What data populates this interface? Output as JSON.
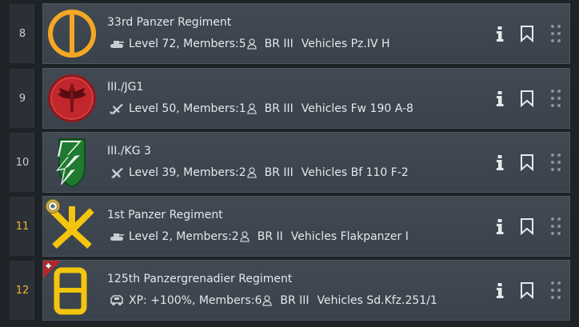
{
  "colors": {
    "card_bg": "#3d454e",
    "rank_gold": "#f2b62a",
    "emblem_orange": "#f5a623",
    "emblem_yellow": "#f4c50e",
    "emblem_red": "#c1272d",
    "emblem_green": "#1f7a30",
    "corner_red": "#b8262b"
  },
  "rows": [
    {
      "rank": "8",
      "name": "33rd Panzer Regiment",
      "vehicle_icon": "tank-icon",
      "stat": "Level 72, Members:5",
      "br": "BR III",
      "vehicles": "Vehicles Pz.IV H",
      "emblem": "orange-circle-bar-emblem"
    },
    {
      "rank": "9",
      "name": "III./JG1",
      "vehicle_icon": "fighter-plane-icon",
      "stat": "Level 50, Members:1",
      "br": "BR III",
      "vehicles": "Vehicles Fw 190 A-8",
      "emblem": "red-winged-sword-emblem"
    },
    {
      "rank": "10",
      "name": "III./KG 3",
      "vehicle_icon": "bomber-plane-icon",
      "stat": "Level 39, Members:2",
      "br": "BR III",
      "vehicles": "Vehicles Bf 110 F-2",
      "emblem": "green-lightning-shield-emblem"
    },
    {
      "rank": "11",
      "name": "1st Panzer Regiment",
      "vehicle_icon": "tank-icon",
      "stat": "Level 2, Members:2",
      "br": "BR II",
      "vehicles": "Vehicles Flakpanzer I",
      "emblem": "yellow-y-fork-emblem",
      "badge": "medal-icon"
    },
    {
      "rank": "12",
      "name": "125th Panzergrenadier Regiment",
      "vehicle_icon": "armored-car-icon",
      "stat": "XP: +100%, Members:6",
      "br": "BR III",
      "vehicles": "Vehicles Sd.Kfz.251/1",
      "emblem": "yellow-rounded-box-emblem",
      "badge": "iron-cross-corner-icon"
    }
  ]
}
